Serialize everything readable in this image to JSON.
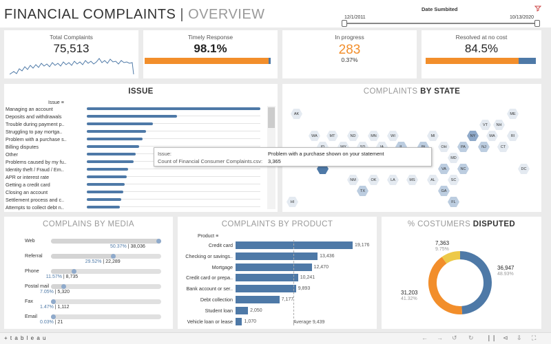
{
  "header": {
    "title_main": "FINANCIAL COMPLAINTS",
    "title_sep": "|",
    "title_sub": "OVERVIEW",
    "date_label": "Date Sumbited",
    "date_from": "12/1/2011",
    "date_to": "10/13/2020"
  },
  "kpis": {
    "total": {
      "label": "Total Complaints",
      "value": "75,513"
    },
    "timely": {
      "label": "Timely Response",
      "value": "98.1%",
      "fill_pct": 98.1
    },
    "progress": {
      "label": "In progress",
      "value": "283",
      "sub": "0.37%"
    },
    "resolved": {
      "label": "Resolved at no cost",
      "value": "84.5%",
      "fill_pct": 84.5
    }
  },
  "issue": {
    "title": "ISSUE",
    "header": "Issue",
    "items": [
      {
        "label": "Managing an account",
        "value": 100
      },
      {
        "label": "Deposits and withdrawals",
        "value": 52
      },
      {
        "label": "Trouble during payment p..",
        "value": 38
      },
      {
        "label": "Struggling to pay mortga..",
        "value": 34
      },
      {
        "label": "Problem with a purchase s..",
        "value": 32
      },
      {
        "label": "Billing disputes",
        "value": 30
      },
      {
        "label": "Other",
        "value": 28
      },
      {
        "label": "Problems caused by my fu..",
        "value": 27
      },
      {
        "label": "Identity theft / Fraud / Em..",
        "value": 24
      },
      {
        "label": "APR or interest rate",
        "value": 23
      },
      {
        "label": "Getting a credit card",
        "value": 22
      },
      {
        "label": "Closing an account",
        "value": 21
      },
      {
        "label": "Settlement process and c..",
        "value": 20
      },
      {
        "label": "Attempts to collect debt n..",
        "value": 19
      }
    ]
  },
  "tooltip": {
    "issue_label": "Issue:",
    "issue_value": "Problem with a purchase shown on your statement",
    "count_label": "Count of Financial Consumer Complaints.csv:",
    "count_value": "3,365"
  },
  "state": {
    "title_a": "COMPLAINTS ",
    "title_b": "BY STATE",
    "hexes": [
      "AK",
      "ME",
      "VT",
      "NH",
      "WA",
      "MT",
      "ND",
      "MN",
      "WI",
      "MI",
      "NY",
      "MA",
      "RI",
      "ID",
      "WY",
      "SD",
      "IA",
      "IL",
      "IN",
      "OH",
      "PA",
      "NJ",
      "CT",
      "MD",
      "VA",
      "NC",
      "DC",
      "NM",
      "OK",
      "LA",
      "MS",
      "AL",
      "SC",
      "TX",
      "GA",
      "FL",
      "HI"
    ]
  },
  "media": {
    "title_a": "COMPLAINS ",
    "title_b": "BY MEDIA",
    "items": [
      {
        "label": "Web",
        "pct": 50.37,
        "text": "50.37% | 38,036"
      },
      {
        "label": "Referral",
        "pct": 29.52,
        "text": "29.52% | 22,289"
      },
      {
        "label": "Phone",
        "pct": 11.57,
        "text": "11.57% | 8,735"
      },
      {
        "label": "Postal mail",
        "pct": 7.05,
        "text": "7.05% | 5,320"
      },
      {
        "label": "Fax",
        "pct": 1.47,
        "text": "1.47% | 1,112"
      },
      {
        "label": "Email",
        "pct": 0.03,
        "text": "0.03% | 21"
      }
    ]
  },
  "product": {
    "title_a": "COMPLAINTS ",
    "title_b": "BY PRODUCT",
    "header": "Product",
    "average": "Average 9,439",
    "items": [
      {
        "label": "Credit card",
        "value": 19176,
        "text": "19,176"
      },
      {
        "label": "Checking or savings..",
        "value": 13436,
        "text": "13,436"
      },
      {
        "label": "Mortgage",
        "value": 12470,
        "text": "12,470"
      },
      {
        "label": "Credit card or prepa..",
        "value": 10241,
        "text": "10,241"
      },
      {
        "label": "Bank account or ser..",
        "value": 9893,
        "text": "9,893"
      },
      {
        "label": "Debt collection",
        "value": 7177,
        "text": "7,177"
      },
      {
        "label": "Student loan",
        "value": 2050,
        "text": "2,050"
      },
      {
        "label": "Vehicle loan or lease",
        "value": 1070,
        "text": "1,070"
      }
    ]
  },
  "disputed": {
    "title_a": "% COSTUMERS ",
    "title_b": "DISPUTED",
    "slices": [
      {
        "value": "36,947",
        "pct": "48.93%",
        "share": 48.93,
        "color": "#4e79a7"
      },
      {
        "value": "31,203",
        "pct": "41.32%",
        "share": 41.32,
        "color": "#f28e2b"
      },
      {
        "value": "7,363",
        "pct": "9.75%",
        "share": 9.75,
        "color": "#edc948"
      }
    ]
  },
  "footer": {
    "brand": "+ t a b l e a u"
  },
  "colors": {
    "blue": "#4e79a7",
    "orange": "#f28e2b",
    "yellow": "#edc948"
  }
}
